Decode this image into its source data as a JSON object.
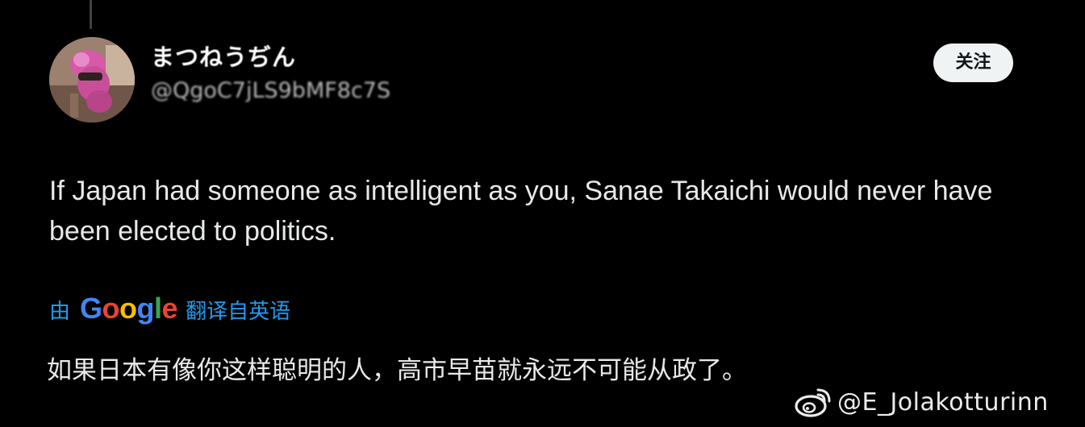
{
  "post": {
    "author": {
      "display_name": "まつねうぢん",
      "handle": "@QgoC7jLS9bMF8c7S"
    },
    "follow_label": "关注",
    "text": "If Japan had someone as intelligent as you, Sanae Takaichi would never have been elected to politics.",
    "translation": {
      "prefix": "由",
      "provider_letters": [
        {
          "char": "G",
          "color": "#4285f4"
        },
        {
          "char": "o",
          "color": "#ea4335"
        },
        {
          "char": "o",
          "color": "#fbbc05"
        },
        {
          "char": "g",
          "color": "#4285f4"
        },
        {
          "char": "l",
          "color": "#34a853"
        },
        {
          "char": "e",
          "color": "#ea4335"
        }
      ],
      "suffix": "翻译自英语",
      "text": "如果日本有像你这样聪明的人，高市早苗就永远不可能从政了。"
    }
  },
  "watermark": {
    "icon": "weibo-logo-icon",
    "text": "@E_Jolakotturinn"
  },
  "colors": {
    "background": "#000000",
    "text": "#e7e9ea",
    "link": "#1d9bf0",
    "follow_bg": "#eff3f4",
    "follow_text": "#0f1419"
  }
}
